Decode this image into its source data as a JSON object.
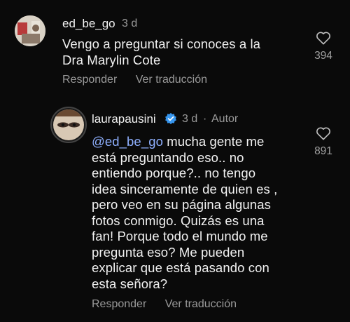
{
  "comments": [
    {
      "username": "ed_be_go",
      "time": "3 d",
      "text": "Vengo a preguntar si conoces a la\nDra Marylin Cote",
      "likes": "394",
      "reply_label": "Responder",
      "translate_label": "Ver traducción"
    },
    {
      "username": "laurapausini",
      "time": "3 d",
      "separator": "·",
      "author_badge": "Autor",
      "verified": true,
      "mention": "@ed_be_go",
      "text": " mucha gente me\nestá preguntando eso.. no\nentiendo porque?.. no tengo\nidea sinceramente de quien es ,\npero veo en su página algunas\nfotos conmigo. Quizás es una\nfan! Porque todo el mundo me\npregunta eso? Me pueden\nexplicar que está pasando con\nesta señora?",
      "likes": "891",
      "reply_label": "Responder",
      "translate_label": "Ver traducción"
    }
  ],
  "colors": {
    "background": "#0a0a0a",
    "text": "#f2f2f2",
    "muted": "#9a9a9a",
    "mention": "#8fb0ff",
    "verified": "#3797f0"
  },
  "icons": [
    "heart-icon",
    "verified-badge-icon"
  ]
}
